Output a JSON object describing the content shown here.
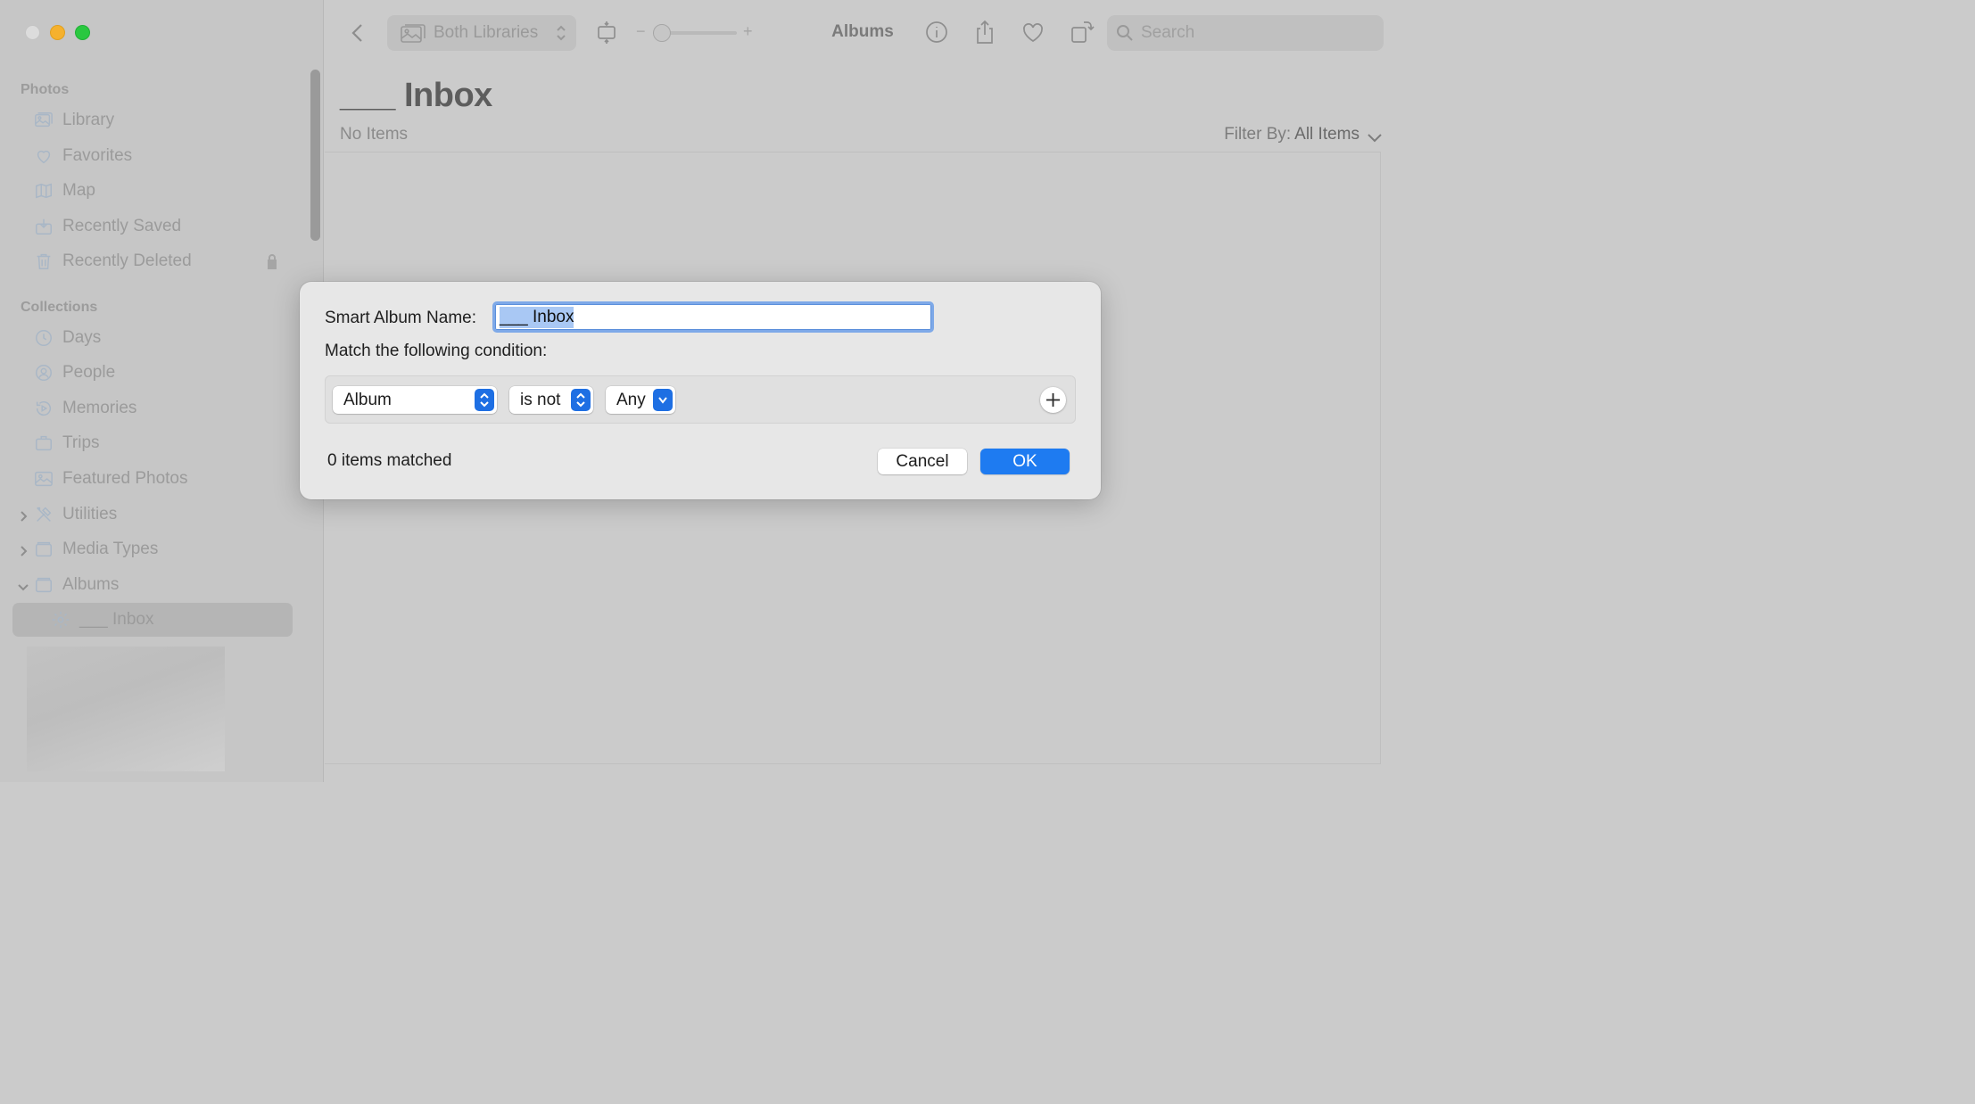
{
  "sidebar": {
    "sections": [
      {
        "title": "Photos"
      },
      {
        "title": "Collections"
      }
    ],
    "items": [
      {
        "label": "Library",
        "icon": "photo-library-icon"
      },
      {
        "label": "Favorites",
        "icon": "heart-icon"
      },
      {
        "label": "Map",
        "icon": "map-icon"
      },
      {
        "label": "Recently Saved",
        "icon": "download-icon"
      },
      {
        "label": "Recently Deleted",
        "icon": "trash-icon"
      },
      {
        "label": "Days",
        "icon": "clock-icon"
      },
      {
        "label": "People",
        "icon": "person-icon"
      },
      {
        "label": "Memories",
        "icon": "memories-icon"
      },
      {
        "label": "Trips",
        "icon": "suitcase-icon"
      },
      {
        "label": "Featured Photos",
        "icon": "photo-icon"
      },
      {
        "label": "Utilities",
        "icon": "tools-icon"
      },
      {
        "label": "Media Types",
        "icon": "folder-icon"
      },
      {
        "label": "Albums",
        "icon": "folder-icon"
      },
      {
        "label": "___ Inbox",
        "icon": "gear-icon",
        "selected": true
      }
    ]
  },
  "toolbar": {
    "library_selector": "Both Libraries",
    "zoom_minus": "−",
    "zoom_plus": "+",
    "zoom_level": 0,
    "title": "Albums",
    "search_placeholder": "Search"
  },
  "main": {
    "title": "___ Inbox",
    "subtitle": "No Items",
    "filter_label": "Filter By:",
    "filter_value": "All Items"
  },
  "dialog": {
    "name_label": "Smart Album Name:",
    "name_value": "___ Inbox",
    "match_label": "Match the following condition:",
    "condition": {
      "field": "Album",
      "operator": "is not",
      "value": "Any"
    },
    "matched_text": "0 items matched",
    "cancel_label": "Cancel",
    "ok_label": "OK"
  },
  "colors": {
    "accent": "#1e7bf1",
    "traffic_close": "#dcdcdc",
    "traffic_minimize": "#f5b12e",
    "traffic_maximize": "#2ac840"
  }
}
